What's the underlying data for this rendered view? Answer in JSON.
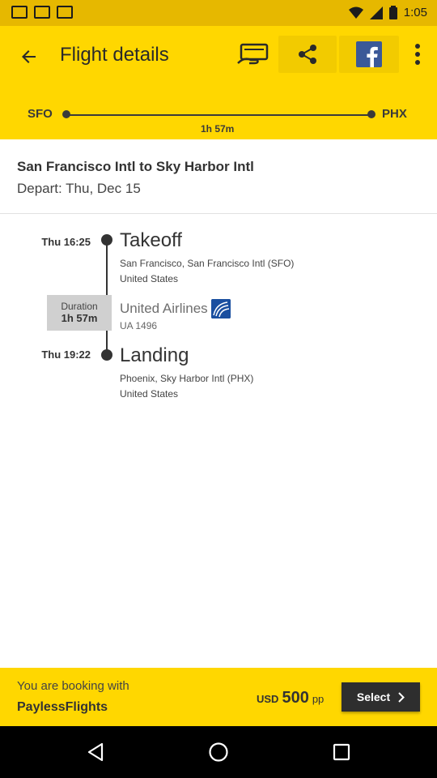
{
  "status_bar": {
    "time": "1:05"
  },
  "app_bar": {
    "title": "Flight details"
  },
  "route": {
    "from": "SFO",
    "to": "PHX",
    "duration": "1h 57m"
  },
  "summary": {
    "heading": "San Francisco Intl to Sky Harbor Intl",
    "depart": "Depart: Thu, Dec 15"
  },
  "timeline": {
    "takeoff": {
      "time": "Thu 16:25",
      "title": "Takeoff",
      "airport": "San Francisco, San Francisco Intl (SFO)",
      "country": "United States"
    },
    "duration_label": "Duration",
    "duration_value": "1h 57m",
    "airline": "United Airlines",
    "flight_number": "UA 1496",
    "landing": {
      "time": "Thu 19:22",
      "title": "Landing",
      "airport": "Phoenix, Sky Harbor Intl (PHX)",
      "country": "United States"
    }
  },
  "footer": {
    "booking_text": "You are booking with",
    "provider": "PaylessFlights",
    "currency": "USD",
    "amount": "500",
    "per": "pp",
    "select_label": "Select"
  },
  "colors": {
    "accent": "#ffd700",
    "status_bar": "#e6b800",
    "button": "#2e2e2e"
  },
  "icons": [
    "back-arrow-icon",
    "money-icon",
    "share-icon",
    "facebook-icon",
    "more-vert-icon",
    "chevron-right-icon",
    "united-logo-icon"
  ]
}
